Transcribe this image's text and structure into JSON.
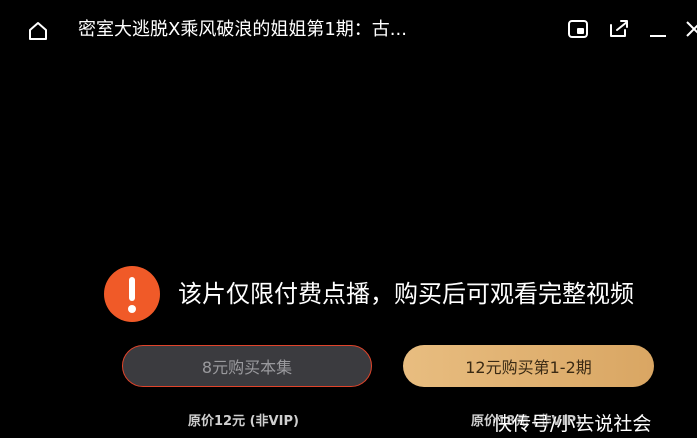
{
  "header": {
    "title": "密室大逃脱X乘风破浪的姐姐第1期：古..."
  },
  "icons": {
    "home": "home-icon",
    "pip": "picture-in-picture-icon",
    "share": "share-icon",
    "minimize": "minimize-icon",
    "close": "close-icon",
    "alert": "exclamation-icon"
  },
  "notice": {
    "text": "该片仅限付费点播，购买后可观看完整视频"
  },
  "purchase": {
    "episode_label": "8元购买本集",
    "season_label": "12元购买第1-2期",
    "episode_price_note": "原价12元 (非VIP)",
    "season_price_note": "原价18元 (非VIP)"
  },
  "watermark": {
    "text": "快传号/小去说社会"
  },
  "colors": {
    "background": "#000000",
    "alert": "#f05a28",
    "gold_button": "#e3b574",
    "dark_button": "#3b3b3f",
    "dark_button_border": "#e0442b"
  }
}
